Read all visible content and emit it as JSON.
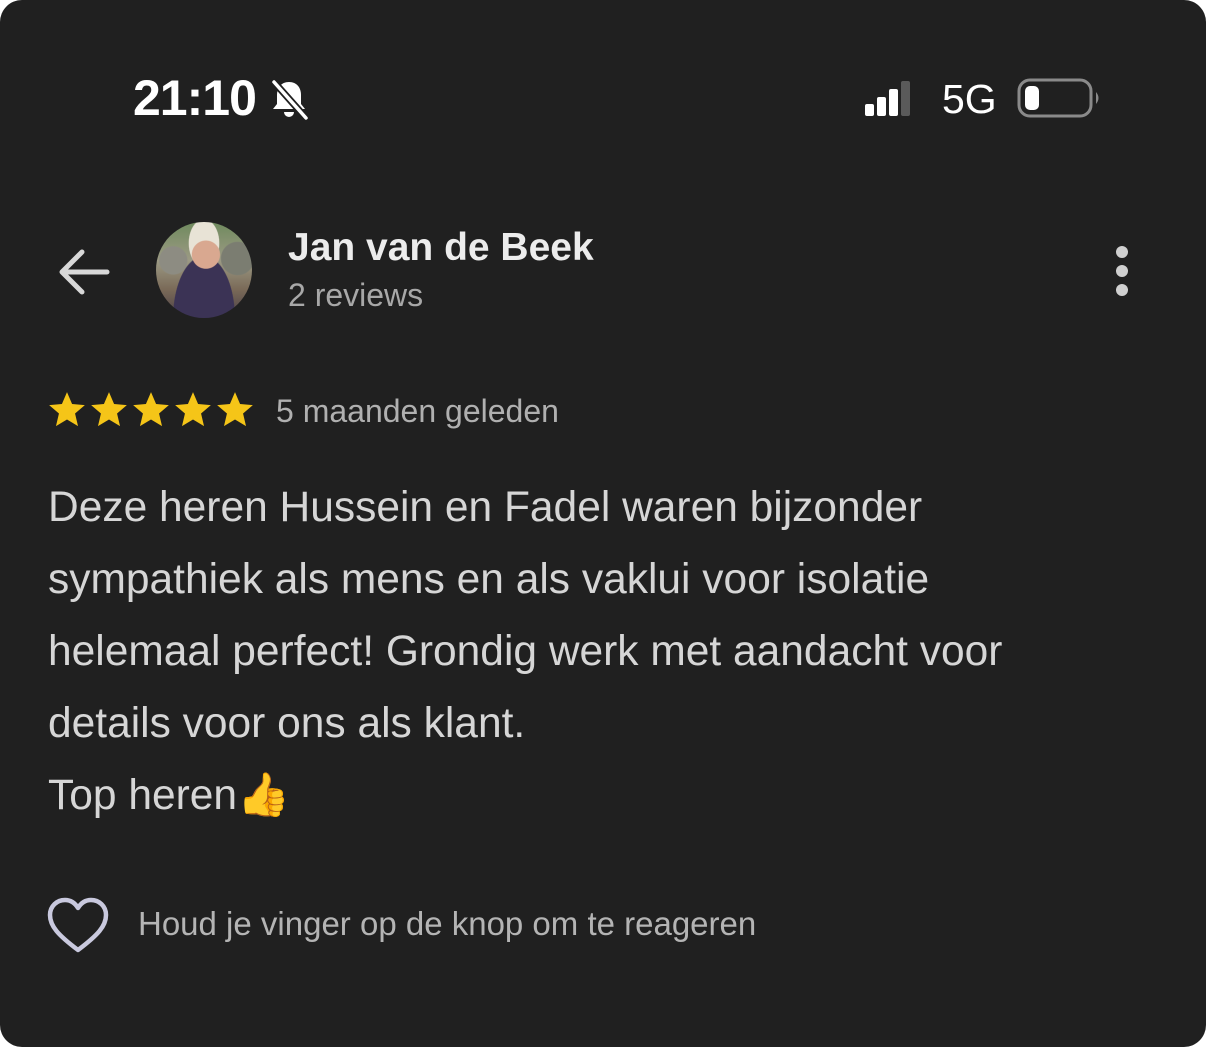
{
  "status_bar": {
    "time": "21:10",
    "silent_icon": "bell-slash-icon",
    "signal_icon": "cellular-signal-icon",
    "network": "5G",
    "battery_icon": "battery-low-icon"
  },
  "header": {
    "back_icon": "arrow-left-icon",
    "reviewer_name": "Jan van de Beek",
    "review_count": "2 reviews",
    "more_icon": "more-vertical-icon"
  },
  "review": {
    "rating": 5,
    "rating_max": 5,
    "star_color": "#F5C518",
    "date": "5 maanden geleden",
    "text": "Deze heren Hussein en Fadel waren bijzonder\nsympathiek als mens en als vaklui voor isolatie\nhelemaal perfect! Grondig werk met aandacht voor\ndetails voor ons als klant.\nTop heren👍"
  },
  "reaction": {
    "heart_icon": "heart-outline-icon",
    "hint": "Houd je vinger op de knop om te reageren"
  }
}
